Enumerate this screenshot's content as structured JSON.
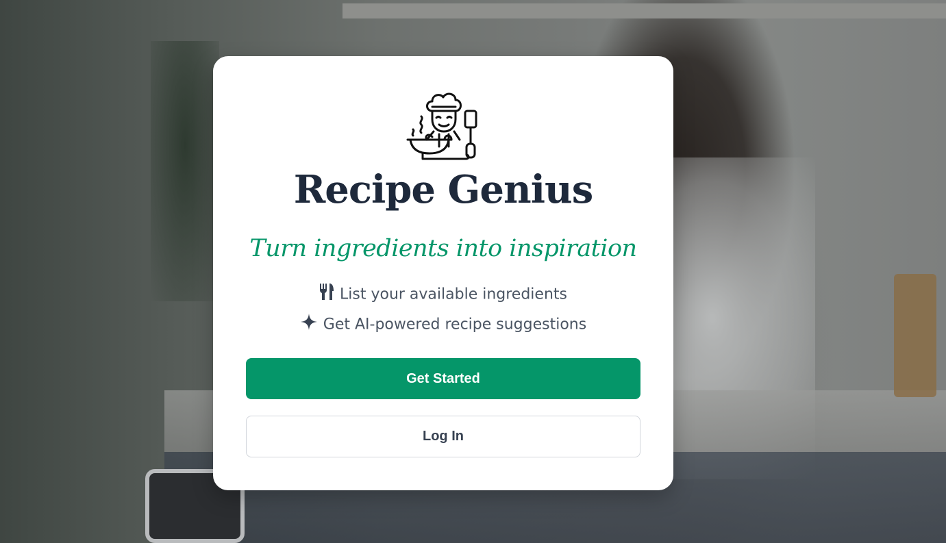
{
  "app": {
    "title": "Recipe Genius",
    "tagline": "Turn ingredients into inspiration"
  },
  "features": [
    {
      "icon": "utensils-icon",
      "label": "List your available ingredients"
    },
    {
      "icon": "sparkle-icon",
      "label": "Get AI-powered recipe suggestions"
    }
  ],
  "actions": {
    "primary_label": "Get Started",
    "secondary_label": "Log In"
  },
  "colors": {
    "accent": "#059669",
    "title": "#1e293b",
    "body_text": "#4b5563",
    "card_bg": "#ffffff"
  },
  "background": {
    "description_icon": "kitchen-photo"
  }
}
